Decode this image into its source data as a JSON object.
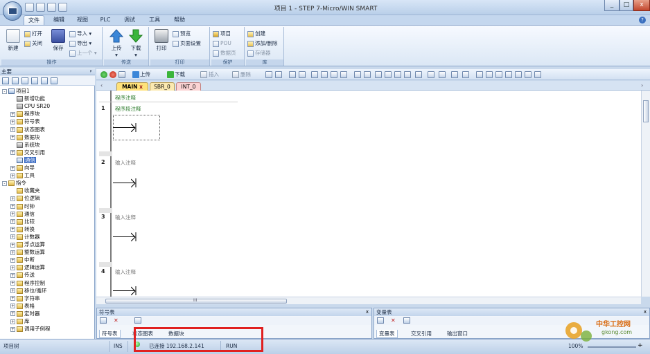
{
  "window": {
    "title": "项目 1 - STEP 7-Micro/WIN SMART"
  },
  "menu": {
    "tabs": [
      "文件",
      "编辑",
      "视图",
      "PLC",
      "调试",
      "工具",
      "帮助"
    ]
  },
  "ribbon": {
    "operations": {
      "label": "操作",
      "new": "新建",
      "open": "打开",
      "close": "关闭",
      "save": "保存",
      "import": "导入",
      "export": "导出",
      "previous": "上一个"
    },
    "transfer": {
      "label": "传送",
      "upload": "上传",
      "download": "下载"
    },
    "print": {
      "label": "打印",
      "print": "打印",
      "preview": "预览",
      "page_setup": "页面设置"
    },
    "protect": {
      "label": "保护",
      "project": "项目",
      "pou": "POU",
      "data_page": "数据页"
    },
    "library": {
      "label": "库",
      "create": "创建",
      "add_delete": "添加/删除",
      "memory": "存储器"
    }
  },
  "left_panel": {
    "title": "主要",
    "tree": [
      {
        "label": "项目1",
        "level": 0,
        "expander": "-",
        "icon": "pc"
      },
      {
        "label": "新增功能",
        "level": 1,
        "expander": "",
        "icon": "gray"
      },
      {
        "label": "CPU SR20",
        "level": 1,
        "expander": "",
        "icon": "gray"
      },
      {
        "label": "程序块",
        "level": 1,
        "expander": "+",
        "icon": "folder"
      },
      {
        "label": "符号表",
        "level": 1,
        "expander": "+",
        "icon": "folder"
      },
      {
        "label": "状态图表",
        "level": 1,
        "expander": "+",
        "icon": "folder"
      },
      {
        "label": "数据块",
        "level": 1,
        "expander": "+",
        "icon": "folder"
      },
      {
        "label": "系统块",
        "level": 1,
        "expander": "",
        "icon": "gray"
      },
      {
        "label": "交叉引用",
        "level": 1,
        "expander": "+",
        "icon": "folder"
      },
      {
        "label": "通信",
        "level": 1,
        "expander": "",
        "icon": "pc",
        "selected": true
      },
      {
        "label": "向导",
        "level": 1,
        "expander": "+",
        "icon": "folder"
      },
      {
        "label": "工具",
        "level": 1,
        "expander": "+",
        "icon": "folder"
      },
      {
        "label": "指令",
        "level": 0,
        "expander": "-",
        "icon": "folder"
      },
      {
        "label": "收藏夹",
        "level": 1,
        "expander": "",
        "icon": "folder"
      },
      {
        "label": "位逻辑",
        "level": 1,
        "expander": "+",
        "icon": "folder"
      },
      {
        "label": "时钟",
        "level": 1,
        "expander": "+",
        "icon": "folder"
      },
      {
        "label": "通信",
        "level": 1,
        "expander": "+",
        "icon": "folder"
      },
      {
        "label": "比较",
        "level": 1,
        "expander": "+",
        "icon": "folder"
      },
      {
        "label": "转换",
        "level": 1,
        "expander": "+",
        "icon": "folder"
      },
      {
        "label": "计数器",
        "level": 1,
        "expander": "+",
        "icon": "folder"
      },
      {
        "label": "浮点运算",
        "level": 1,
        "expander": "+",
        "icon": "folder"
      },
      {
        "label": "整数运算",
        "level": 1,
        "expander": "+",
        "icon": "folder"
      },
      {
        "label": "中断",
        "level": 1,
        "expander": "+",
        "icon": "folder"
      },
      {
        "label": "逻辑运算",
        "level": 1,
        "expander": "+",
        "icon": "folder"
      },
      {
        "label": "传送",
        "level": 1,
        "expander": "+",
        "icon": "folder"
      },
      {
        "label": "程序控制",
        "level": 1,
        "expander": "+",
        "icon": "folder"
      },
      {
        "label": "移位/循环",
        "level": 1,
        "expander": "+",
        "icon": "folder"
      },
      {
        "label": "字符串",
        "level": 1,
        "expander": "+",
        "icon": "folder"
      },
      {
        "label": "表格",
        "level": 1,
        "expander": "+",
        "icon": "folder"
      },
      {
        "label": "定时器",
        "level": 1,
        "expander": "+",
        "icon": "folder"
      },
      {
        "label": "库",
        "level": 1,
        "expander": "+",
        "icon": "folder"
      },
      {
        "label": "调用子例程",
        "level": 1,
        "expander": "+",
        "icon": "folder"
      }
    ]
  },
  "editor_toolbar": {
    "upload": "上传",
    "download": "下载",
    "insert": "插入",
    "delete": "删除"
  },
  "pou_tabs": [
    {
      "label": "MAIN",
      "active": true
    },
    {
      "label": "SBR_0",
      "active": false
    },
    {
      "label": "INT_0",
      "active": false
    }
  ],
  "editor": {
    "program_comment": "程序注释",
    "networks": [
      {
        "number": "1",
        "comment": "程序段注释"
      },
      {
        "number": "2",
        "comment": "输入注释"
      },
      {
        "number": "3",
        "comment": "输入注释"
      },
      {
        "number": "4",
        "comment": "输入注释"
      }
    ],
    "hscroll_marker": "III"
  },
  "symbol_panel": {
    "title": "符号表",
    "tabs": [
      "符号表",
      "状态图表",
      "数据块"
    ]
  },
  "variable_panel": {
    "title": "变量表",
    "tabs": [
      "变量表",
      "交叉引用",
      "输出窗口"
    ]
  },
  "statusbar": {
    "project_tree": "项目树",
    "ins": "INS",
    "connection": "已连接 192.168.2.141",
    "run": "RUN",
    "zoom": "100%"
  },
  "watermark": {
    "text": "中华工控网",
    "url": "gkong.com"
  },
  "colors": {
    "accent": "#3b6cc4",
    "frame": "#c4d7ee",
    "highlight": "#e02020",
    "online": "#1fa01f"
  }
}
